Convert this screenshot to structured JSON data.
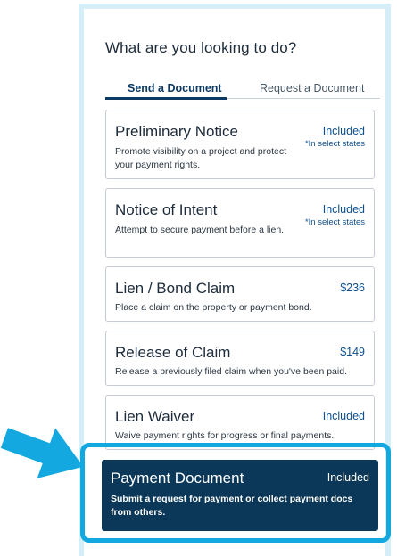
{
  "header": {
    "title": "What are you looking to do?"
  },
  "tabs": [
    {
      "label": "Send a Document",
      "active": true
    },
    {
      "label": "Request a Document",
      "active": false
    }
  ],
  "cards": [
    {
      "title": "Preliminary Notice",
      "price": "Included",
      "note": "*In select states",
      "desc": "Promote visibility on a project and protect your payment rights."
    },
    {
      "title": "Notice of Intent",
      "price": "Included",
      "note": "*In select states",
      "desc": "Attempt to secure payment before a lien."
    },
    {
      "title": "Lien / Bond Claim",
      "price": "$236",
      "note": "",
      "desc": "Place a claim on the property or payment bond."
    },
    {
      "title": "Release of Claim",
      "price": "$149",
      "note": "",
      "desc": "Release a previously filed claim when you've been paid."
    },
    {
      "title": "Lien Waiver",
      "price": "Included",
      "note": "",
      "desc": "Waive payment rights for progress or final payments."
    },
    {
      "title": "Payment Document",
      "price": "Included",
      "note": "",
      "selected": true,
      "desc": "Submit a request for payment or collect payment docs from others."
    }
  ],
  "colors": {
    "brand_navy": "#0b3859",
    "accent_cyan": "#13a9e0",
    "link_blue": "#0f4f8c",
    "frame_tint": "#d5eef8"
  }
}
